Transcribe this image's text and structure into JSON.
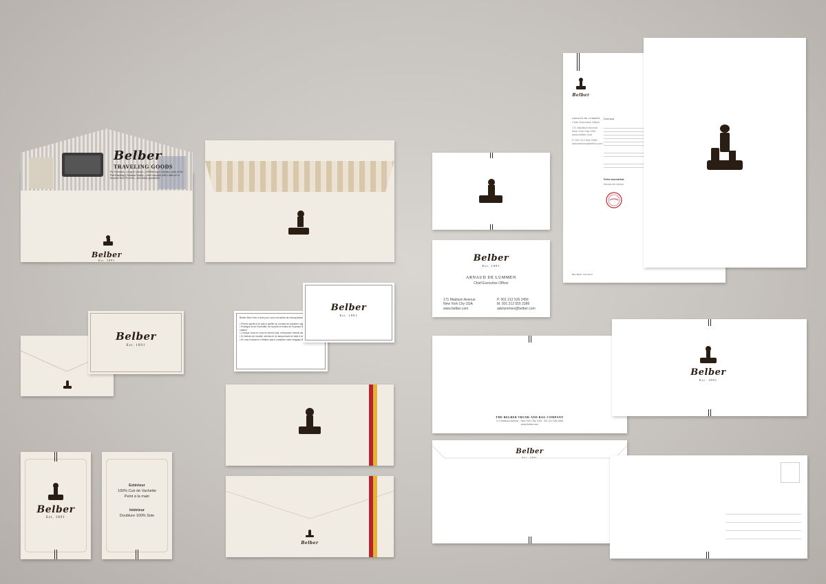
{
  "brand": {
    "name": "Belber",
    "established": "Est. 1891",
    "company_line": "THE BELBER TRUNK AND BAG COMPANY",
    "company_address": "171 Madison Avenue - New York City, USA - 001 212 526 2456",
    "website": "www.belber.com"
  },
  "vintage_ad": {
    "headline": "Belber",
    "subheadline": "TRAVELING GOODS",
    "body": "For Christmas—a bag or suitcase—a Belber bag or suitcase—most of the Fine Handbags Christmas Quality—fitted complete with a toilet set of beautiful Ivory Py-ra-lin—and doubly guaranteed."
  },
  "business_card": {
    "name": "ARNAUD DE LUMMEN",
    "title": "Chief Executive Officer",
    "address_line1": "171 Madison Avenue",
    "address_line2": "New York City USA",
    "website": "www.belber.com",
    "phone": "P. 001 212 526 2456",
    "mobile": "M. 001 212 555 2386",
    "email": "adelummen@belber.com"
  },
  "care_card": {
    "intro": "Belber New York a créé pour vous cet article de maroquinerie de qualité...",
    "items": [
      "• Prenez garde à ne pas le greffer au contact de surfaces rugueuses",
      "• Protégez-le de l'humidité, de la pluie et évitez de l'exposer aux sources de chaleur",
      "• Lorsque vous ne vous en servez pas, entreposez l'article dans son emballage",
      "• Si l'article est mouillé, séchez-le en tamponnant à l'aide d'un tissu",
      "• En cas d'incident, n'hésitez pas à contacter votre magasin Belber"
    ]
  },
  "tag": {
    "exterior_label": "Extérieur",
    "exterior_value1": "100% Cuir de Vachette",
    "exterior_value2": "Peint à la main",
    "interior_label": "Intérieur",
    "interior_value": "Doublure 100% Soie"
  },
  "letterhead": {
    "name": "ARNAUD DE LUMMEN",
    "title": "Chief Executive Officer",
    "salutation": "Domqua",
    "closing": "Pellet amendebat",
    "signature_name": "futurorum minus",
    "footer": "BELBER TRUNKS"
  },
  "colors": {
    "cream": "#f1ece3",
    "ink": "#2a1d14",
    "stripe_red": "#b3262a",
    "stripe_yellow": "#e6b23a",
    "stamp_red": "#c8323a"
  }
}
